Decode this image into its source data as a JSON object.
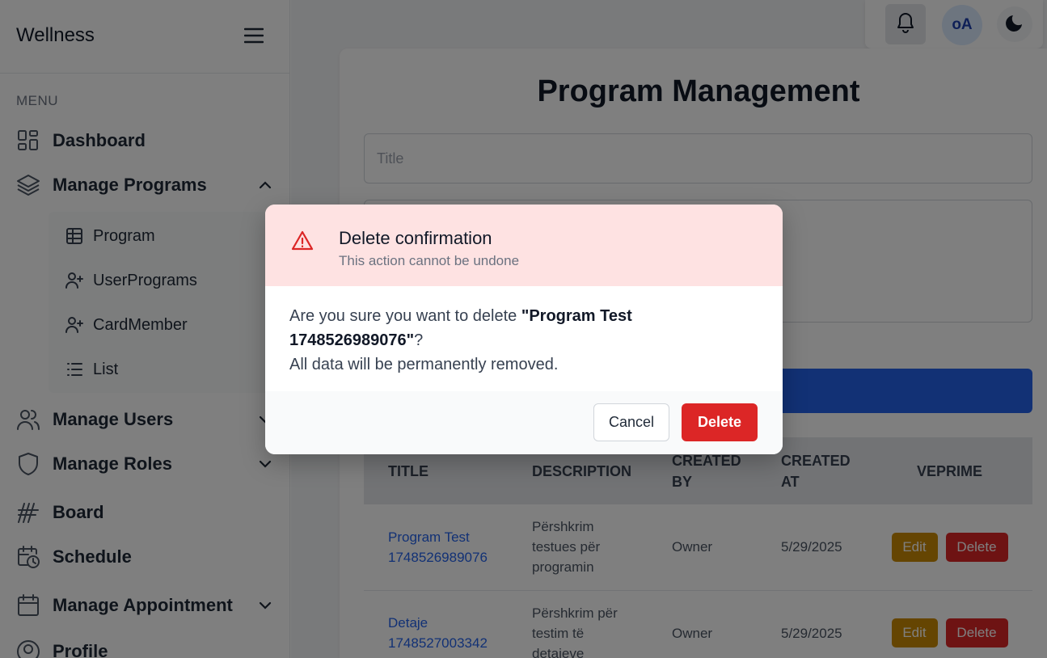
{
  "sidebar": {
    "brand": "Wellness",
    "menu_label": "MENU",
    "items": [
      {
        "label": "Dashboard",
        "icon": "dashboard-icon"
      },
      {
        "label": "Manage Programs",
        "icon": "layers-icon",
        "expanded": true
      },
      {
        "label": "Manage Users",
        "icon": "users-icon"
      },
      {
        "label": "Manage Roles",
        "icon": "shield-icon"
      },
      {
        "label": "Board",
        "icon": "board-icon"
      },
      {
        "label": "Schedule",
        "icon": "calendar-clock-icon"
      },
      {
        "label": "Manage Appointment",
        "icon": "calendar-icon"
      },
      {
        "label": "Profile",
        "icon": "user-circle-icon"
      }
    ],
    "subitems": [
      {
        "label": "Program",
        "icon": "table-icon"
      },
      {
        "label": "UserPrograms",
        "icon": "user-plus-icon"
      },
      {
        "label": "CardMember",
        "icon": "user-plus-icon"
      },
      {
        "label": "List",
        "icon": "list-icon"
      }
    ]
  },
  "topbar": {
    "avatar_initials": "oA"
  },
  "main": {
    "title": "Program Management",
    "title_placeholder": "Title",
    "table": {
      "headers": [
        "TITLE",
        "DESCRIPTION",
        "CREATED BY",
        "CREATED AT",
        "VEPRIME"
      ],
      "rows": [
        {
          "title": "Program Test 1748526989076",
          "description": "Përshkrim testues për programin",
          "created_by": "Owner",
          "created_at": "5/29/2025",
          "edit": "Edit",
          "delete": "Delete"
        },
        {
          "title": "Detaje 1748527003342",
          "description": "Përshkrim për testim të detajeve",
          "created_by": "Owner",
          "created_at": "5/29/2025",
          "edit": "Edit",
          "delete": "Delete"
        }
      ]
    }
  },
  "modal": {
    "title": "Delete confirmation",
    "subtitle": "This action cannot be undone",
    "body_prefix": "Are you sure you want to delete ",
    "item_name": "\"Program Test 1748526989076\"",
    "body_suffix": "?",
    "body_line2": "All data will be permanently removed.",
    "cancel": "Cancel",
    "delete": "Delete"
  },
  "colors": {
    "primary": "#2563eb",
    "danger": "#dc2626",
    "warning": "#ca8a04",
    "modal_header": "#fee2e2"
  }
}
